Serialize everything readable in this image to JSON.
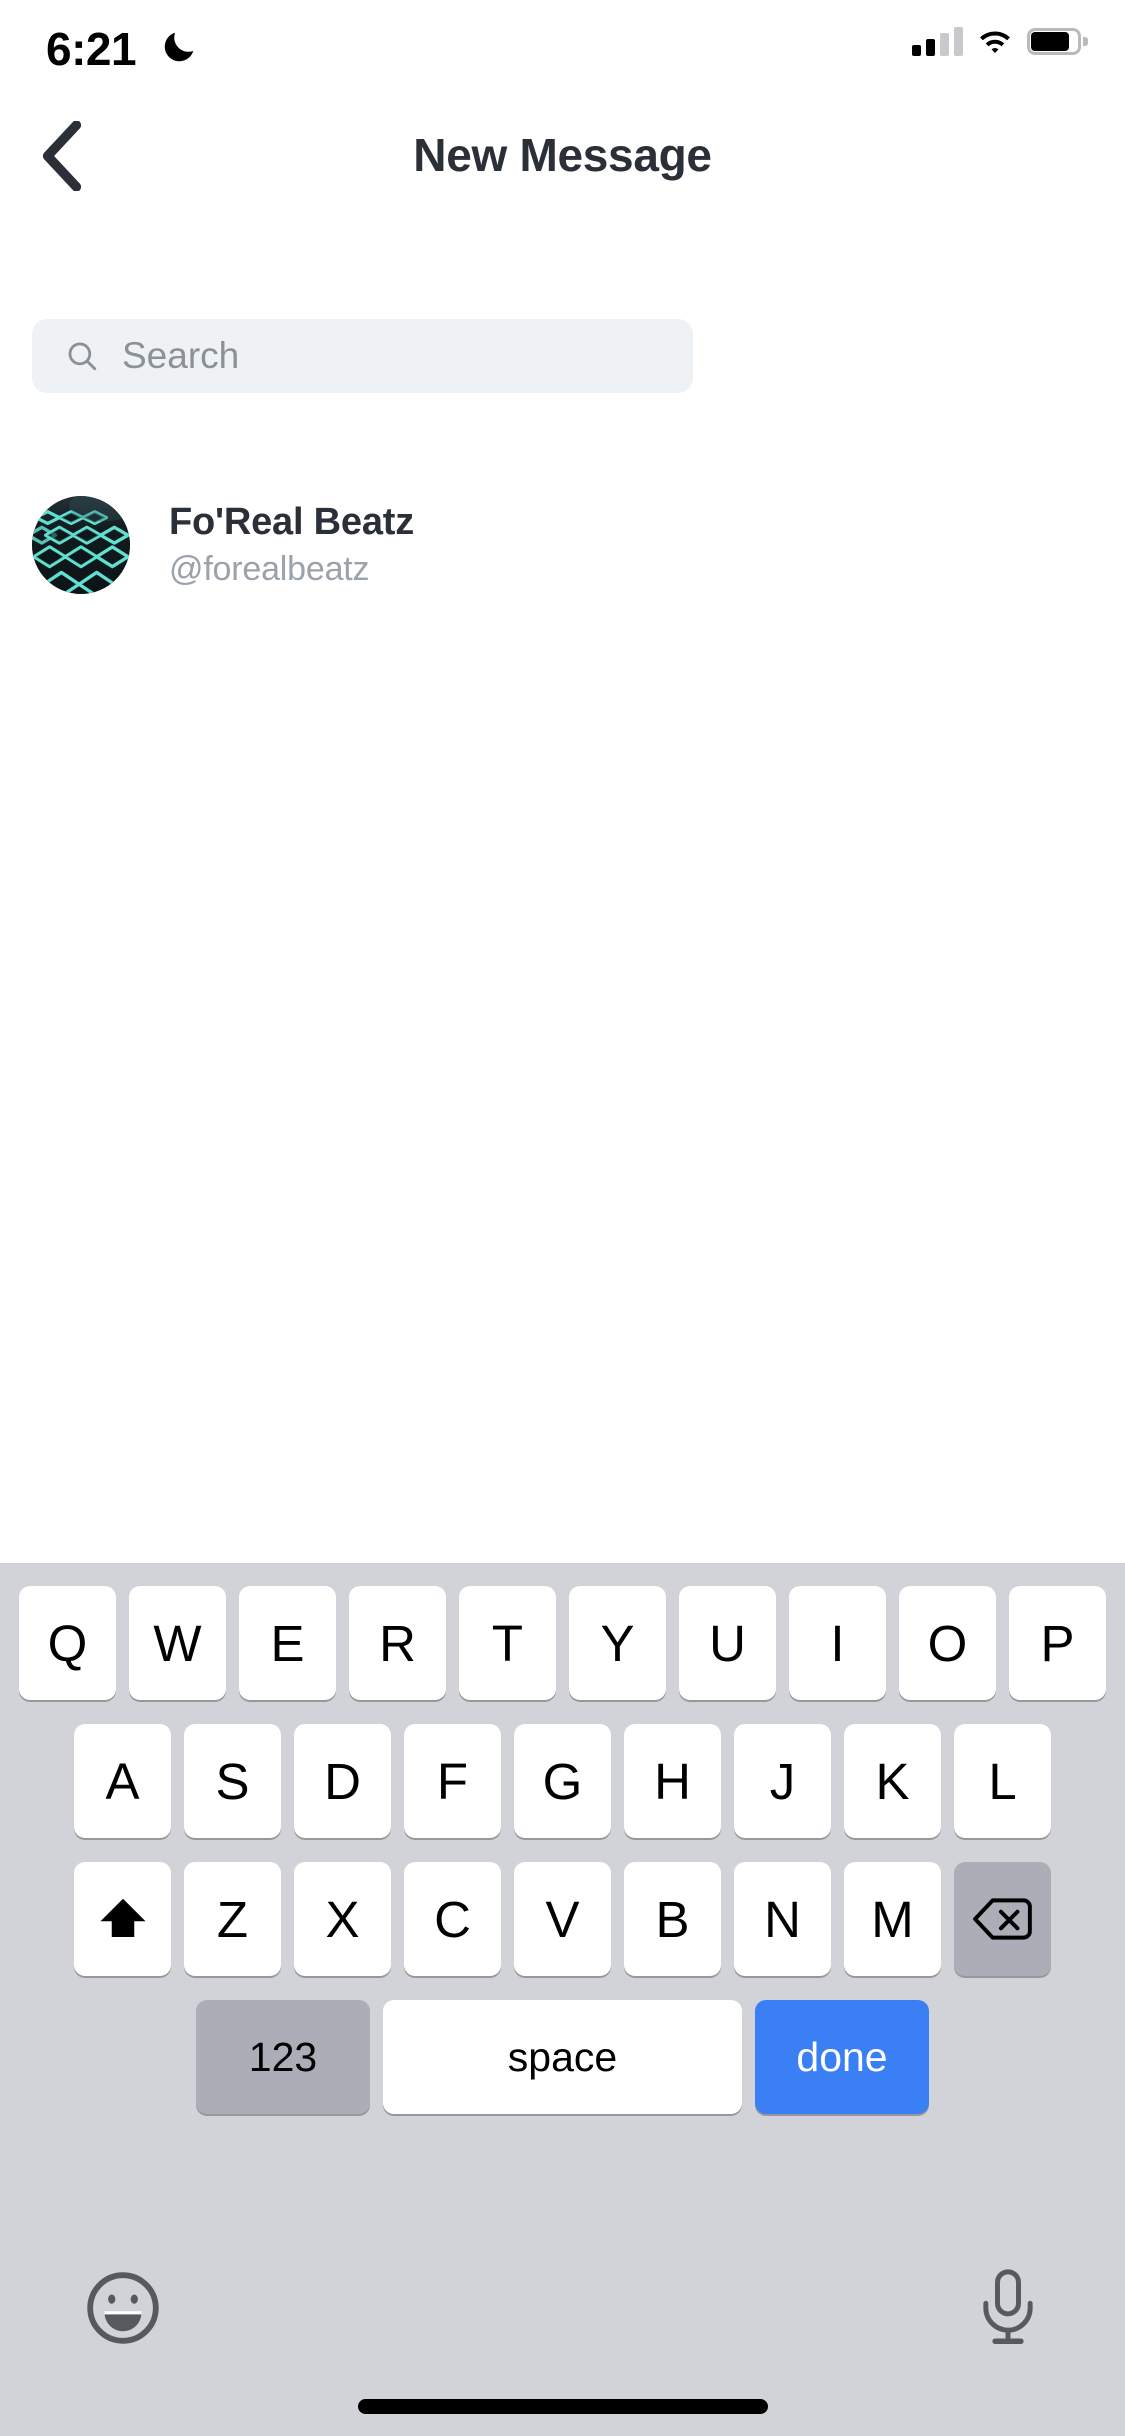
{
  "status_bar": {
    "time": "6:21",
    "dnd_icon": "crescent-moon-icon",
    "signal_icon": "cellular-signal-icon",
    "wifi_icon": "wifi-icon",
    "battery_icon": "battery-icon",
    "signal_bars_active": 2,
    "signal_bars_total": 4,
    "battery_level_percent": 90
  },
  "navbar": {
    "back_icon": "chevron-left-icon",
    "title": "New Message"
  },
  "search": {
    "icon": "search-icon",
    "placeholder": "Search",
    "value": ""
  },
  "contacts": [
    {
      "name": "Fo'Real Beatz",
      "handle": "@forealbeatz",
      "avatar_description": "drum-pad-grid-avatar",
      "avatar_colors": {
        "background": "#10191c",
        "accent": "#62e0d2"
      }
    }
  ],
  "keyboard": {
    "background": "#d1d3d9",
    "row1": [
      "Q",
      "W",
      "E",
      "R",
      "T",
      "Y",
      "U",
      "I",
      "O",
      "P"
    ],
    "row2": [
      "A",
      "S",
      "D",
      "F",
      "G",
      "H",
      "J",
      "K",
      "L"
    ],
    "row3_shift_icon": "shift-arrow-up-icon",
    "row3": [
      "Z",
      "X",
      "C",
      "V",
      "B",
      "N",
      "M"
    ],
    "row3_backspace_icon": "backspace-delete-icon",
    "row4": {
      "numbers_label": "123",
      "space_label": "space",
      "done_label": "done",
      "done_color": "#3b7ff5",
      "modifier_color": "#abaeb6"
    },
    "bottom_bar": {
      "emoji_icon": "emoji-smiley-icon",
      "mic_icon": "microphone-icon"
    }
  },
  "home_indicator": "home-indicator-bar"
}
